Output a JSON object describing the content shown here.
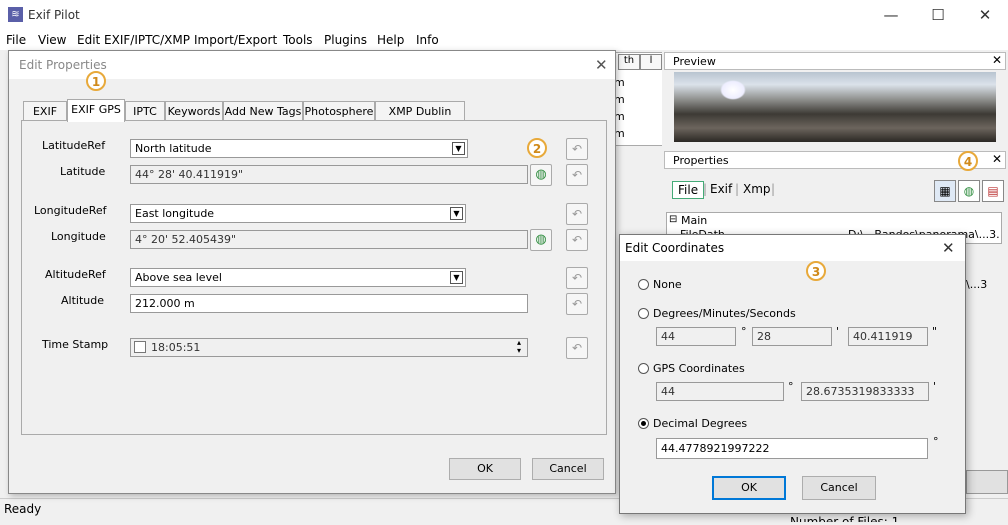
{
  "app": {
    "title": "Exif Pilot",
    "logo": "logo-icon"
  },
  "window_controls": {
    "minimize": "—",
    "maximize": "☐",
    "close": "✕"
  },
  "menu": [
    "File",
    "View",
    "Edit EXIF/IPTC/XMP",
    "Import/Export",
    "Tools",
    "Plugins",
    "Help",
    "Info"
  ],
  "background_grid": {
    "headers": [
      "th",
      "l"
    ],
    "cells": [
      "m",
      "m",
      "m",
      "m"
    ]
  },
  "preview": {
    "title": "Preview",
    "close": "✕"
  },
  "properties": {
    "title": "Properties",
    "close": "✕",
    "tabs": [
      "File",
      "Exif",
      "Xmp"
    ],
    "separator": "|",
    "tree_root": "Main",
    "tree_toggle": "⊟",
    "tree_row": "FileDath",
    "tree_value": "D:\\...Bandos\\panorama\\...3...",
    "tree_value2": "\\...3"
  },
  "status": {
    "ready": "Ready",
    "files": "Number of Files: 1"
  },
  "edit_properties": {
    "title": "Edit Properties",
    "close": "✕",
    "tabs": [
      "EXIF",
      "EXIF GPS",
      "IPTC",
      "Keywords",
      "Add New Tags",
      "Photosphere",
      "XMP Dublin Core"
    ],
    "active_tab": "EXIF GPS",
    "latitude_ref": {
      "label": "LatitudeRef",
      "value": "North latitude"
    },
    "latitude": {
      "label": "Latitude",
      "value": "44° 28' 40.411919\""
    },
    "longitude_ref": {
      "label": "LongitudeRef",
      "value": "East longitude"
    },
    "longitude": {
      "label": "Longitude",
      "value": "4° 20' 52.405439\""
    },
    "altitude_ref": {
      "label": "AltitudeRef",
      "value": "Above sea level"
    },
    "altitude": {
      "label": "Altitude",
      "value": "212.000 m"
    },
    "time_stamp": {
      "label": "Time Stamp",
      "value": "18:05:51"
    },
    "ok": "OK",
    "cancel": "Cancel"
  },
  "edit_coordinates": {
    "title": "Edit Coordinates",
    "close": "✕",
    "options": {
      "none": "None",
      "dms": "Degrees/Minutes/Seconds",
      "gps": "GPS Coordinates",
      "decimal": "Decimal Degrees"
    },
    "selected": "decimal",
    "dms_values": {
      "degrees": "44",
      "minutes": "28",
      "seconds": "40.411919",
      "deg_sym": "°",
      "min_sym": "'",
      "sec_sym": "\""
    },
    "gps_values": {
      "degrees": "44",
      "minutes": "28.6735319833333",
      "deg_sym": "°",
      "min_sym": "'"
    },
    "decimal_value": "44.4778921997222",
    "decimal_sym": "°",
    "ok": "OK",
    "cancel": "Cancel"
  },
  "badges": [
    "1",
    "2",
    "3",
    "4"
  ],
  "icons": {
    "globe": "globe-icon",
    "undo": "undo-icon",
    "spin_up": "▴",
    "spin_down": "▾",
    "dropdown": "▼"
  }
}
